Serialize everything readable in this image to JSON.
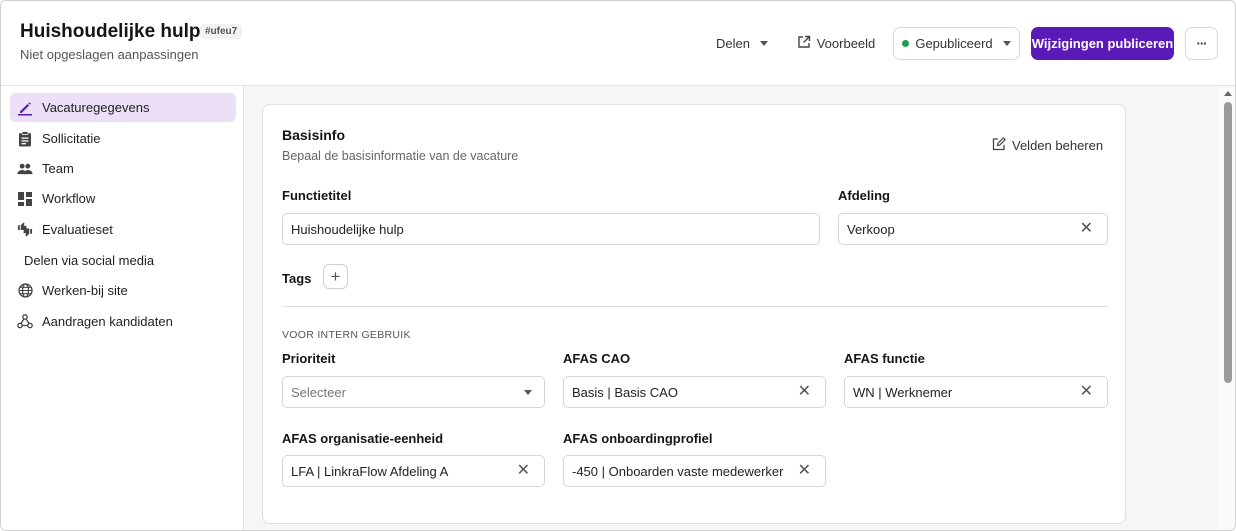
{
  "header": {
    "title": "Huishoudelijke hulp",
    "code": "#ufeu7",
    "subtitle": "Niet opgeslagen aanpassingen",
    "share_label": "Delen",
    "preview_label": "Voorbeeld",
    "status_label": "Gepubliceerd",
    "publish_label": "Wijzigingen publiceren",
    "more_label": "···",
    "colors": {
      "publish_bg": "#5a1ab8",
      "status_dot": "#1f9d55"
    }
  },
  "sidebar": {
    "items": [
      {
        "label": "Vacaturegegevens",
        "icon": "pencil-icon",
        "active": true
      },
      {
        "label": "Sollicitatie",
        "icon": "clipboard-icon"
      },
      {
        "label": "Team",
        "icon": "people-icon"
      },
      {
        "label": "Workflow",
        "icon": "dashboard-icon"
      },
      {
        "label": "Evaluatieset",
        "icon": "thumbs-icon"
      },
      {
        "label": "Delen via social media",
        "icon": ""
      },
      {
        "label": "Werken-bij site",
        "icon": "globe-icon"
      },
      {
        "label": "Aandragen kandidaten",
        "icon": "network-icon"
      }
    ]
  },
  "card": {
    "title": "Basisinfo",
    "subtitle": "Bepaal de basisinformatie van de vacature",
    "manage_label": "Velden beheren",
    "fields": {
      "functietitel": {
        "label": "Functietitel",
        "value": "Huishoudelijke hulp"
      },
      "afdeling": {
        "label": "Afdeling",
        "value": "Verkoop"
      },
      "tags": {
        "label": "Tags"
      }
    },
    "section_internal": "VOOR INTERN GEBRUIK",
    "internal": {
      "prioriteit": {
        "label": "Prioriteit",
        "placeholder": "Selecteer"
      },
      "afas_cao": {
        "label": "AFAS CAO",
        "value": "Basis | Basis CAO"
      },
      "afas_functie": {
        "label": "AFAS functie",
        "value": "WN | Werknemer"
      },
      "afas_org": {
        "label": "AFAS organisatie-eenheid",
        "value": "LFA | LinkraFlow Afdeling A"
      },
      "afas_onboarding": {
        "label": "AFAS onboardingprofiel",
        "value": "-450 | Onboarden vaste medewerker"
      }
    }
  }
}
